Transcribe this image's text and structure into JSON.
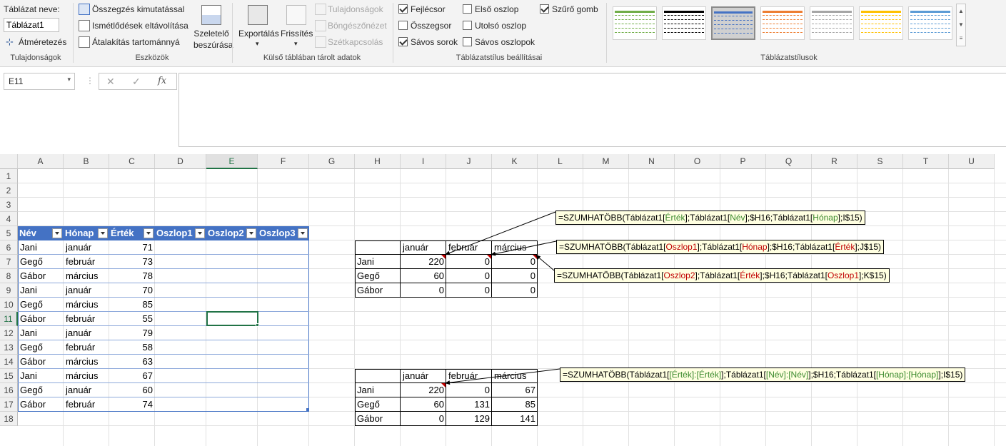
{
  "ribbon": {
    "props": {
      "label": "Táblázat neve:",
      "name": "Táblázat1",
      "resize": "Átméretezés",
      "group": "Tulajdonságok"
    },
    "tools": {
      "pivot": "Összegzés kimutatással",
      "dedupe": "Ismétlődések eltávolítása",
      "convert": "Átalakítás tartománnyá",
      "slicer1": "Szeletelő",
      "slicer2": "beszúrása",
      "group": "Eszközök"
    },
    "external": {
      "export": "Exportálás",
      "refresh": "Frissítés",
      "properties": "Tulajdonságok",
      "browser": "Böngészőnézet",
      "unlink": "Szétkapcsolás",
      "group": "Külső táblában tárolt adatok"
    },
    "styleopts": {
      "header_row": "Fejlécsor",
      "total_row": "Összegsor",
      "banded_rows": "Sávos sorok",
      "first_col": "Első oszlop",
      "last_col": "Utolsó oszlop",
      "banded_cols": "Sávos oszlopok",
      "filter_btn": "Szűrő gomb",
      "group": "Táblázatstílus beállításai"
    },
    "styles": {
      "group": "Táblázatstílusok",
      "swatches": [
        "#70ad47",
        "#000000",
        "#4472c4",
        "#ed7d31",
        "#a5a5a5",
        "#ffc000",
        "#5b9bd5"
      ]
    }
  },
  "formula_bar": {
    "namebox": "E11",
    "fx": "fx"
  },
  "columns": [
    "A",
    "B",
    "C",
    "D",
    "E",
    "F",
    "G",
    "H",
    "I",
    "J",
    "K",
    "L",
    "M",
    "N",
    "O",
    "P",
    "Q",
    "R",
    "S",
    "T",
    "U"
  ],
  "rows": [
    "1",
    "2",
    "3",
    "4",
    "5",
    "6",
    "7",
    "8",
    "9",
    "10",
    "11",
    "12",
    "13",
    "14",
    "15",
    "16",
    "17",
    "18"
  ],
  "table": {
    "headers": [
      "Név",
      "Hónap",
      "Érték",
      "Oszlop1",
      "Oszlop2",
      "Oszlop3"
    ],
    "rows": [
      [
        "Jani",
        "január",
        "71"
      ],
      [
        "Gegő",
        "február",
        "73"
      ],
      [
        "Gábor",
        "március",
        "78"
      ],
      [
        "Jani",
        "január",
        "70"
      ],
      [
        "Gegő",
        "március",
        "85"
      ],
      [
        "Gábor",
        "február",
        "55"
      ],
      [
        "Jani",
        "január",
        "79"
      ],
      [
        "Gegő",
        "február",
        "58"
      ],
      [
        "Gábor",
        "március",
        "63"
      ],
      [
        "Jani",
        "március",
        "67"
      ],
      [
        "Gegő",
        "január",
        "60"
      ],
      [
        "Gábor",
        "február",
        "74"
      ]
    ]
  },
  "summary1": {
    "months": [
      "január",
      "február",
      "március"
    ],
    "names": [
      "Jani",
      "Gegő",
      "Gábor"
    ],
    "values": [
      [
        "220",
        "0",
        "0"
      ],
      [
        "60",
        "0",
        "0"
      ],
      [
        "0",
        "0",
        "0"
      ]
    ]
  },
  "summary2": {
    "months": [
      "január",
      "február",
      "március"
    ],
    "names": [
      "Jani",
      "Gegő",
      "Gábor"
    ],
    "values": [
      [
        "220",
        "0",
        "67"
      ],
      [
        "60",
        "131",
        "85"
      ],
      [
        "0",
        "129",
        "141"
      ]
    ]
  },
  "notes": {
    "n1": [
      "=SZUMHATÖBB(Táblázat1[",
      "Érték",
      "];Táblázat1[",
      "Név",
      "];$H16;Táblázat1[",
      "Hónap",
      "];I$15)"
    ],
    "n2": [
      "=SZUMHATÖBB(Táblázat1[",
      "Oszlop1",
      "];Táblázat1[",
      "Hónap",
      "];$H16;Táblázat1[",
      "Érték",
      "];J$15)"
    ],
    "n3": [
      "=SZUMHATÖBB(Táblázat1[",
      "Oszlop2",
      "];Táblázat1[",
      "Érték",
      "];$H16;Táblázat1[",
      "Oszlop1",
      "];K$15)"
    ],
    "n4": [
      "=SZUMHATÖBB(Táblázat1[",
      "[Érték]:[Érték]",
      "];Táblázat1[",
      "[Név]:[Név]",
      "];$H16;Táblázat1[",
      "[Hónap]:[Hónap]",
      "];I$15)"
    ]
  }
}
